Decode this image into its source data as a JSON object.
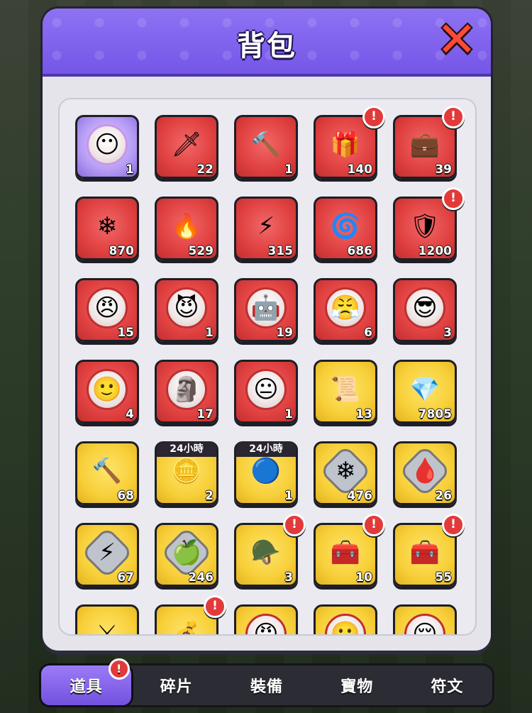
{
  "dialog": {
    "title": "背包",
    "close_icon": "close-x-icon"
  },
  "inventory": [
    {
      "name": "hero-shard-pink",
      "bg": "purple",
      "icon": "😶",
      "kind": "portrait",
      "count": "1",
      "alert": false
    },
    {
      "name": "green-blade",
      "bg": "red",
      "icon": "🗡",
      "kind": "plain",
      "count": "22",
      "alert": false
    },
    {
      "name": "orange-hammer",
      "bg": "red",
      "icon": "🔨",
      "kind": "plain",
      "count": "1",
      "alert": false
    },
    {
      "name": "treasure-chest-gems",
      "bg": "red",
      "icon": "🎁",
      "kind": "plain",
      "count": "140",
      "alert": true
    },
    {
      "name": "purple-gem-box",
      "bg": "red",
      "icon": "💼",
      "kind": "plain",
      "count": "39",
      "alert": true
    },
    {
      "name": "blue-snowflake-stone",
      "bg": "red",
      "icon": "❄",
      "kind": "plain",
      "count": "870",
      "alert": false
    },
    {
      "name": "red-fire-stone",
      "bg": "red",
      "icon": "🔥",
      "kind": "plain",
      "count": "529",
      "alert": false
    },
    {
      "name": "yellow-lightning-stone",
      "bg": "red",
      "icon": "⚡",
      "kind": "plain",
      "count": "315",
      "alert": false
    },
    {
      "name": "green-wind-stone",
      "bg": "red",
      "icon": "🌀",
      "kind": "plain",
      "count": "686",
      "alert": false
    },
    {
      "name": "shield-chest",
      "bg": "red",
      "icon": "🛡",
      "kind": "plain",
      "count": "1200",
      "alert": true
    },
    {
      "name": "hero-shard-purple-hair",
      "bg": "red",
      "icon": "😠",
      "kind": "portrait",
      "count": "15",
      "alert": false
    },
    {
      "name": "hero-shard-blue",
      "bg": "red",
      "icon": "😈",
      "kind": "portrait",
      "count": "1",
      "alert": false
    },
    {
      "name": "hero-shard-robot",
      "bg": "red",
      "icon": "🤖",
      "kind": "portrait",
      "count": "19",
      "alert": false
    },
    {
      "name": "hero-shard-dark-hair",
      "bg": "red",
      "icon": "😤",
      "kind": "portrait",
      "count": "6",
      "alert": false
    },
    {
      "name": "hero-shard-bandit",
      "bg": "red",
      "icon": "😎",
      "kind": "portrait",
      "count": "3",
      "alert": false
    },
    {
      "name": "hero-shard-long-hair",
      "bg": "red",
      "icon": "🙂",
      "kind": "portrait",
      "count": "4",
      "alert": false
    },
    {
      "name": "hero-shard-golem",
      "bg": "red",
      "icon": "🗿",
      "kind": "portrait",
      "count": "17",
      "alert": false
    },
    {
      "name": "hero-shard-silver-hair",
      "bg": "red",
      "icon": "😐",
      "kind": "portrait",
      "count": "1",
      "alert": false
    },
    {
      "name": "scroll",
      "bg": "yellow",
      "icon": "📜",
      "kind": "plain",
      "count": "13",
      "alert": false
    },
    {
      "name": "blue-diamond",
      "bg": "yellow",
      "icon": "💎",
      "kind": "plain",
      "count": "7805",
      "alert": false
    },
    {
      "name": "purple-hammer",
      "bg": "yellow",
      "icon": "🔨",
      "kind": "plain",
      "count": "68",
      "alert": false
    },
    {
      "name": "gold-coins-24h",
      "bg": "yellow",
      "icon": "🪙",
      "kind": "plain",
      "count": "2",
      "alert": false,
      "tag": "24小時"
    },
    {
      "name": "blue-coins-24h",
      "bg": "yellow",
      "icon": "🔵",
      "kind": "plain",
      "count": "1",
      "alert": false,
      "tag": "24小時"
    },
    {
      "name": "blue-flower-rune",
      "bg": "yellow",
      "icon": "❄",
      "kind": "gem",
      "count": "476",
      "alert": false
    },
    {
      "name": "red-drop-rune",
      "bg": "yellow",
      "icon": "🩸",
      "kind": "gem",
      "count": "26",
      "alert": false
    },
    {
      "name": "lightning-rune",
      "bg": "yellow",
      "icon": "⚡",
      "kind": "gem",
      "count": "67",
      "alert": false
    },
    {
      "name": "green-apple-rune",
      "bg": "yellow",
      "icon": "🍏",
      "kind": "gem",
      "count": "246",
      "alert": false
    },
    {
      "name": "knight-card",
      "bg": "yellow",
      "icon": "🪖",
      "kind": "plain",
      "count": "3",
      "alert": true
    },
    {
      "name": "purple-chest",
      "bg": "yellow",
      "icon": "🧰",
      "kind": "plain",
      "count": "10",
      "alert": true
    },
    {
      "name": "green-chest",
      "bg": "yellow",
      "icon": "🧰",
      "kind": "plain",
      "count": "55",
      "alert": true
    },
    {
      "name": "gold-sword-badge",
      "bg": "yellow",
      "icon": "⚔",
      "kind": "plain",
      "count": "",
      "alert": false
    },
    {
      "name": "silver-coins-pack",
      "bg": "yellow",
      "icon": "💰",
      "kind": "plain",
      "count": "",
      "alert": true
    },
    {
      "name": "hero-shard-red",
      "bg": "yellow",
      "icon": "😡",
      "kind": "portrait",
      "count": "",
      "alert": false
    },
    {
      "name": "hero-shard-gold-a",
      "bg": "yellow",
      "icon": "🙂",
      "kind": "portrait",
      "count": "",
      "alert": false
    },
    {
      "name": "hero-shard-gold-b",
      "bg": "yellow",
      "icon": "😌",
      "kind": "portrait",
      "count": "",
      "alert": false
    }
  ],
  "tabs": [
    {
      "label": "道具",
      "active": true,
      "alert": true
    },
    {
      "label": "碎片",
      "active": false,
      "alert": false
    },
    {
      "label": "裝備",
      "active": false,
      "alert": false
    },
    {
      "label": "寶物",
      "active": false,
      "alert": false
    },
    {
      "label": "符文",
      "active": false,
      "alert": false
    }
  ],
  "alert_glyph": "!"
}
